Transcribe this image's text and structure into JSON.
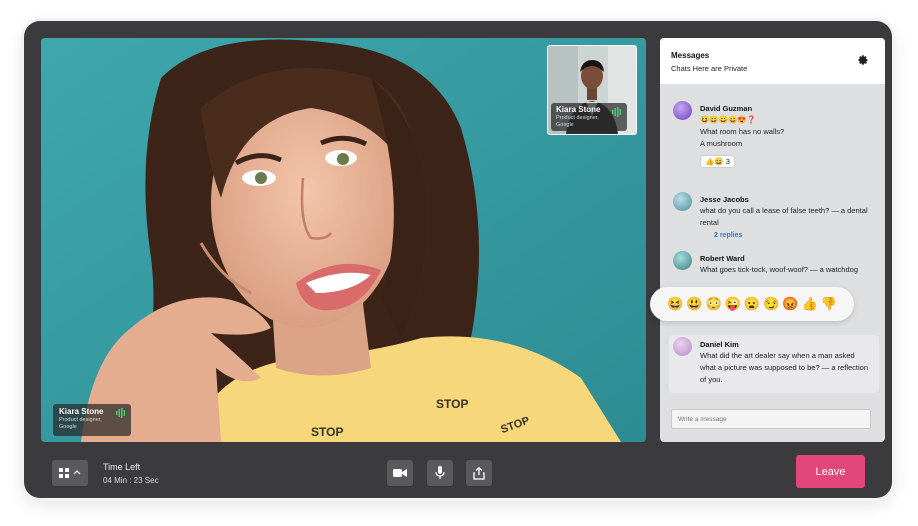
{
  "main_video": {
    "participant_name": "Kiara Stone",
    "participant_role": "Product designer, Google"
  },
  "pip_video": {
    "participant_name": "Kiara Stone",
    "participant_role": "Product designer, Google"
  },
  "messages_panel": {
    "title": "Messages",
    "subtitle": "Chats Here are Private",
    "write_placeholder": "Write a message",
    "messages": [
      {
        "author": "David Guzman",
        "lines": [
          "😆😄😄😄😍❓",
          "What room has no walls?",
          "A mushroom"
        ],
        "reactions": "👍😄 3"
      },
      {
        "author": "Jesse Jacobs",
        "lines": [
          "what do you call a lease of false teeth? — a dental",
          "rental"
        ],
        "replies": "2 replies"
      },
      {
        "author": "Robert Ward",
        "lines": [
          "What goes tick-tock, woof-woof? — a watchdog"
        ]
      },
      {
        "author": "Daniel Kim",
        "lines": [
          "What did the art dealer say when a man asked",
          "what a picture was supposed to be? — a reflection",
          "of you."
        ]
      }
    ],
    "emoji_picker": [
      "😆",
      "😃",
      "😳",
      "😜",
      "😦",
      "😏",
      "😡",
      "👍",
      "👎"
    ]
  },
  "bottom_bar": {
    "time_left_label": "Time Left",
    "time_left_value": "04 Min : 23 Sec",
    "leave_label": "Leave"
  },
  "colors": {
    "leave": "#e3467a",
    "frame": "#3b3a3c",
    "video_bg": "#3a9aa0",
    "replies_link": "#2f7fd6"
  }
}
